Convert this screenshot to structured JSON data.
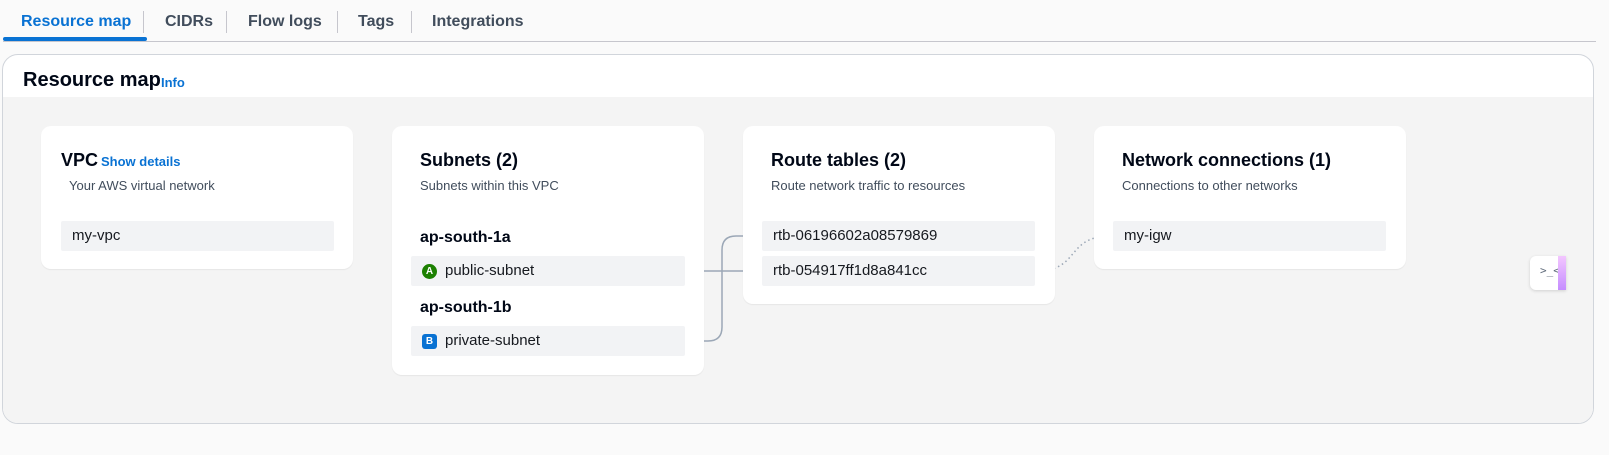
{
  "tabs": [
    {
      "label": "Resource map",
      "active": true
    },
    {
      "label": "CIDRs",
      "active": false
    },
    {
      "label": "Flow logs",
      "active": false
    },
    {
      "label": "Tags",
      "active": false
    },
    {
      "label": "Integrations",
      "active": false
    }
  ],
  "panel": {
    "title": "Resource map",
    "info_link": "Info"
  },
  "vpc": {
    "title": "VPC",
    "show_details": "Show details",
    "subtitle": "Your AWS virtual network",
    "item": "my-vpc"
  },
  "subnets": {
    "title": "Subnets (2)",
    "subtitle": "Subnets within this VPC",
    "groups": [
      {
        "zone": "ap-south-1a",
        "badge": "A",
        "subnet": "public-subnet"
      },
      {
        "zone": "ap-south-1b",
        "badge": "B",
        "subnet": "private-subnet"
      }
    ]
  },
  "route_tables": {
    "title": "Route tables (2)",
    "subtitle": "Route network traffic to resources",
    "items": [
      "rtb-06196602a08579869",
      "rtb-054917ff1d8a841cc"
    ]
  },
  "network_connections": {
    "title": "Network connections (1)",
    "subtitle": "Connections to other networks",
    "items": [
      "my-igw"
    ]
  },
  "side_widget": {
    "glyph": ">_<"
  },
  "colors": {
    "accent": "#0972d3",
    "zone_a": "#1d8102",
    "zone_b": "#0972d3",
    "connector": "#9ba7b6"
  }
}
